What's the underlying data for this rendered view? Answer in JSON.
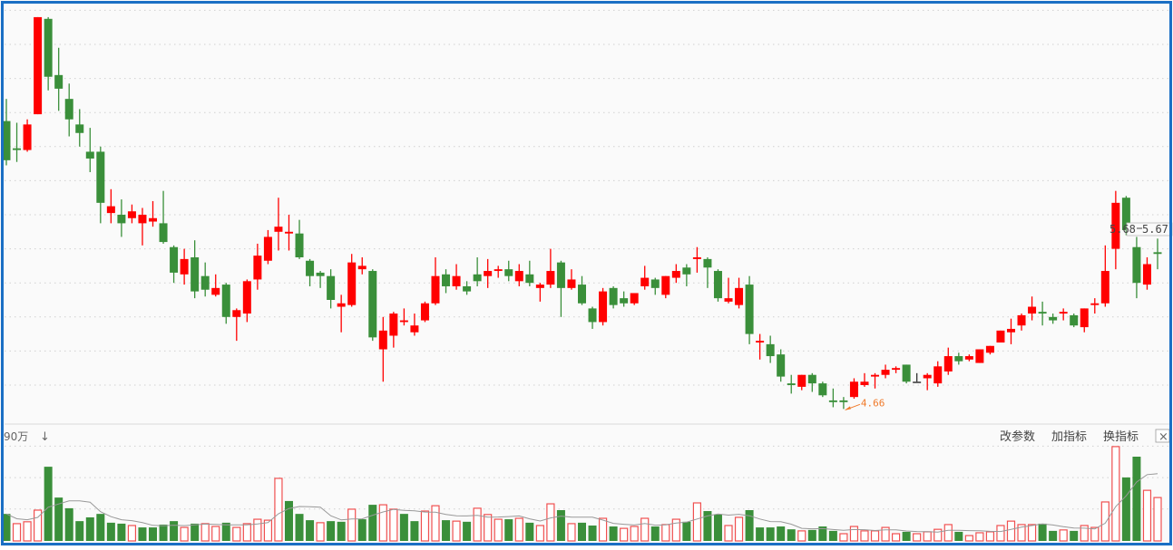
{
  "chart_data": [
    {
      "type": "candlestick",
      "title": "",
      "ylim": [
        4.66,
        6.96
      ],
      "grid": true,
      "gridlines": [
        4.8,
        5.0,
        5.2,
        5.4,
        5.6,
        5.8,
        6.0,
        6.2,
        6.4,
        6.6,
        6.8,
        7.0
      ],
      "ohlc_fields": [
        "open",
        "high",
        "low",
        "close"
      ],
      "candles": [
        [
          6.35,
          6.48,
          6.09,
          6.12
        ],
        [
          6.19,
          6.34,
          6.11,
          6.18
        ],
        [
          6.18,
          6.36,
          6.17,
          6.33
        ],
        [
          6.39,
          6.96,
          6.39,
          6.96
        ],
        [
          6.95,
          6.96,
          6.53,
          6.61
        ],
        [
          6.62,
          6.78,
          6.41,
          6.54
        ],
        [
          6.48,
          6.57,
          6.26,
          6.36
        ],
        [
          6.33,
          6.42,
          6.2,
          6.28
        ],
        [
          6.17,
          6.31,
          6.05,
          6.13
        ],
        [
          6.17,
          6.2,
          5.75,
          5.87
        ],
        [
          5.81,
          5.95,
          5.75,
          5.85
        ],
        [
          5.8,
          5.89,
          5.67,
          5.75
        ],
        [
          5.78,
          5.86,
          5.75,
          5.82
        ],
        [
          5.75,
          5.84,
          5.62,
          5.8
        ],
        [
          5.76,
          5.88,
          5.73,
          5.78
        ],
        [
          5.75,
          5.94,
          5.63,
          5.64
        ],
        [
          5.61,
          5.62,
          5.4,
          5.46
        ],
        [
          5.45,
          5.6,
          5.39,
          5.54
        ],
        [
          5.55,
          5.65,
          5.31,
          5.35
        ],
        [
          5.44,
          5.52,
          5.32,
          5.36
        ],
        [
          5.33,
          5.45,
          5.32,
          5.37
        ],
        [
          5.39,
          5.4,
          5.16,
          5.2
        ],
        [
          5.2,
          5.25,
          5.06,
          5.24
        ],
        [
          5.22,
          5.42,
          5.17,
          5.41
        ],
        [
          5.42,
          5.63,
          5.36,
          5.56
        ],
        [
          5.53,
          5.71,
          5.51,
          5.67
        ],
        [
          5.7,
          5.9,
          5.59,
          5.73
        ],
        [
          5.69,
          5.8,
          5.59,
          5.7
        ],
        [
          5.69,
          5.77,
          5.54,
          5.55
        ],
        [
          5.53,
          5.54,
          5.38,
          5.44
        ],
        [
          5.46,
          5.47,
          5.37,
          5.44
        ],
        [
          5.44,
          5.48,
          5.25,
          5.3
        ],
        [
          5.26,
          5.33,
          5.11,
          5.28
        ],
        [
          5.27,
          5.57,
          5.26,
          5.52
        ],
        [
          5.48,
          5.55,
          5.45,
          5.5
        ],
        [
          5.47,
          5.48,
          5.06,
          5.08
        ],
        [
          5.01,
          5.2,
          4.82,
          5.12
        ],
        [
          5.09,
          5.23,
          5.02,
          5.22
        ],
        [
          5.17,
          5.25,
          5.15,
          5.18
        ],
        [
          5.11,
          5.22,
          5.09,
          5.15
        ],
        [
          5.18,
          5.29,
          5.17,
          5.28
        ],
        [
          5.28,
          5.55,
          5.27,
          5.44
        ],
        [
          5.45,
          5.48,
          5.34,
          5.38
        ],
        [
          5.38,
          5.51,
          5.36,
          5.44
        ],
        [
          5.38,
          5.41,
          5.33,
          5.35
        ],
        [
          5.45,
          5.55,
          5.38,
          5.41
        ],
        [
          5.44,
          5.54,
          5.37,
          5.47
        ],
        [
          5.47,
          5.5,
          5.43,
          5.48
        ],
        [
          5.48,
          5.53,
          5.41,
          5.44
        ],
        [
          5.41,
          5.51,
          5.38,
          5.47
        ],
        [
          5.45,
          5.53,
          5.38,
          5.4
        ],
        [
          5.37,
          5.4,
          5.29,
          5.39
        ],
        [
          5.39,
          5.6,
          5.37,
          5.47
        ],
        [
          5.52,
          5.53,
          5.2,
          5.37
        ],
        [
          5.37,
          5.48,
          5.36,
          5.42
        ],
        [
          5.39,
          5.44,
          5.27,
          5.28
        ],
        [
          5.25,
          5.26,
          5.13,
          5.17
        ],
        [
          5.17,
          5.37,
          5.15,
          5.35
        ],
        [
          5.37,
          5.38,
          5.25,
          5.27
        ],
        [
          5.31,
          5.35,
          5.26,
          5.28
        ],
        [
          5.28,
          5.34,
          5.27,
          5.34
        ],
        [
          5.38,
          5.5,
          5.36,
          5.43
        ],
        [
          5.42,
          5.43,
          5.33,
          5.37
        ],
        [
          5.33,
          5.44,
          5.31,
          5.44
        ],
        [
          5.43,
          5.51,
          5.4,
          5.47
        ],
        [
          5.49,
          5.51,
          5.38,
          5.45
        ],
        [
          5.54,
          5.61,
          5.46,
          5.55
        ],
        [
          5.54,
          5.55,
          5.37,
          5.49
        ],
        [
          5.47,
          5.48,
          5.29,
          5.31
        ],
        [
          5.29,
          5.43,
          5.28,
          5.31
        ],
        [
          5.27,
          5.43,
          5.25,
          5.37
        ],
        [
          5.39,
          5.44,
          5.04,
          5.1
        ],
        [
          5.05,
          5.1,
          4.95,
          5.06
        ],
        [
          5.04,
          5.09,
          4.93,
          4.97
        ],
        [
          4.98,
          5.01,
          4.82,
          4.85
        ],
        [
          4.81,
          4.86,
          4.75,
          4.8
        ],
        [
          4.79,
          4.86,
          4.77,
          4.86
        ],
        [
          4.86,
          4.87,
          4.76,
          4.81
        ],
        [
          4.81,
          4.82,
          4.73,
          4.74
        ],
        [
          4.71,
          4.78,
          4.67,
          4.7
        ],
        [
          4.71,
          4.73,
          4.66,
          4.7
        ],
        [
          4.73,
          4.84,
          4.72,
          4.82
        ],
        [
          4.8,
          4.87,
          4.79,
          4.82
        ],
        [
          4.85,
          4.87,
          4.78,
          4.86
        ],
        [
          4.86,
          4.92,
          4.84,
          4.89
        ],
        [
          4.89,
          4.91,
          4.87,
          4.9
        ],
        [
          4.92,
          4.92,
          4.81,
          4.82
        ],
        [
          4.82,
          4.87,
          4.82,
          4.82
        ],
        [
          4.84,
          4.87,
          4.77,
          4.86
        ],
        [
          4.81,
          4.94,
          4.79,
          4.91
        ],
        [
          4.88,
          5.02,
          4.86,
          4.97
        ],
        [
          4.97,
          4.99,
          4.92,
          4.94
        ],
        [
          4.95,
          4.98,
          4.94,
          4.97
        ],
        [
          4.93,
          5.01,
          4.93,
          5.01
        ],
        [
          4.99,
          5.03,
          4.98,
          5.03
        ],
        [
          5.05,
          5.12,
          5.05,
          5.12
        ],
        [
          5.11,
          5.19,
          5.04,
          5.13
        ],
        [
          5.15,
          5.22,
          5.12,
          5.21
        ],
        [
          5.22,
          5.32,
          5.18,
          5.26
        ],
        [
          5.23,
          5.29,
          5.15,
          5.22
        ],
        [
          5.2,
          5.22,
          5.16,
          5.18
        ],
        [
          5.22,
          5.25,
          5.18,
          5.23
        ],
        [
          5.21,
          5.22,
          5.14,
          5.15
        ],
        [
          5.14,
          5.25,
          5.11,
          5.25
        ],
        [
          5.27,
          5.31,
          5.22,
          5.28
        ],
        [
          5.28,
          5.62,
          5.26,
          5.47
        ],
        [
          5.6,
          5.94,
          5.48,
          5.87
        ],
        [
          5.9,
          5.91,
          5.68,
          5.71
        ],
        [
          5.61,
          5.67,
          5.31,
          5.4
        ],
        [
          5.39,
          5.55,
          5.36,
          5.51
        ],
        [
          5.58,
          5.66,
          5.48,
          5.57
        ]
      ],
      "annotations": {
        "low_label": "4.66",
        "low_index": 80,
        "price_tag_left": "5.68",
        "price_tag_right": "5.67"
      },
      "colors": {
        "up": "#ff0000",
        "down": "#3a8f3a",
        "flat": "#333333",
        "annotation": "#f07a2a"
      }
    },
    {
      "type": "bar",
      "title": "",
      "scale_label": "90万",
      "ylim": [
        0,
        3
      ],
      "grid": true,
      "values": [
        0.86,
        0.55,
        0.61,
        0.98,
        2.36,
        1.38,
        1.04,
        0.63,
        0.75,
        0.86,
        0.58,
        0.55,
        0.49,
        0.43,
        0.43,
        0.52,
        0.63,
        0.43,
        0.55,
        0.55,
        0.46,
        0.58,
        0.43,
        0.55,
        0.69,
        0.66,
        1.99,
        1.27,
        0.86,
        0.66,
        0.58,
        0.63,
        0.61,
        1.01,
        0.69,
        1.15,
        1.15,
        1.01,
        0.86,
        0.63,
        0.95,
        1.12,
        0.66,
        0.63,
        0.61,
        1.04,
        0.84,
        0.69,
        0.69,
        0.72,
        0.58,
        0.49,
        1.18,
        0.98,
        0.55,
        0.58,
        0.49,
        0.72,
        0.46,
        0.4,
        0.46,
        0.72,
        0.46,
        0.52,
        0.69,
        0.61,
        1.21,
        0.95,
        0.84,
        0.49,
        0.75,
        0.98,
        0.43,
        0.43,
        0.46,
        0.37,
        0.32,
        0.35,
        0.46,
        0.32,
        0.23,
        0.46,
        0.32,
        0.32,
        0.43,
        0.23,
        0.29,
        0.23,
        0.29,
        0.37,
        0.52,
        0.29,
        0.17,
        0.26,
        0.29,
        0.49,
        0.63,
        0.52,
        0.52,
        0.55,
        0.32,
        0.35,
        0.32,
        0.49,
        0.43,
        1.24,
        3.0,
        2.02,
        2.68,
        1.61,
        1.38
      ],
      "direction": "GRRRGGGGGGGGRGGGGRGRRGRRRRRGGGRGGRGGRRGGRRGRGRRRGRGRRGRGGRGRRRGRRGRGGRRGGGGGRGGGRRRRRRGRRRRGRRRRRRRGGRGRRRRGGRR",
      "moving_average": true,
      "colors": {
        "up": "#f05050",
        "down": "#3a8f3a",
        "ma": "#999999"
      }
    }
  ],
  "toolbar": {
    "down_arrow": "↓",
    "edit_params": "改参数",
    "add_indicator": "加指标",
    "switch_indicator": "换指标",
    "close": "×"
  },
  "frame_color": "#1a6fc4"
}
